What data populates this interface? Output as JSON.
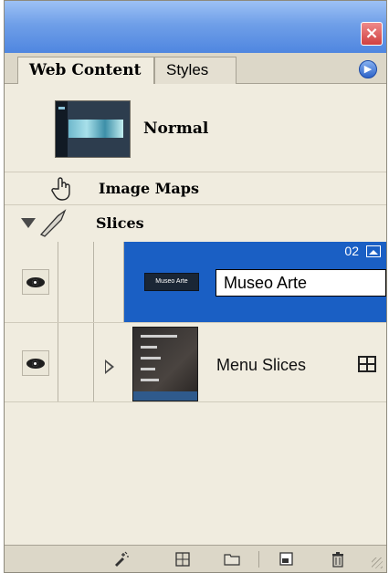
{
  "window": {
    "close_label": "×"
  },
  "tabs": [
    {
      "label": "Web Content",
      "active": true
    },
    {
      "label": "Styles",
      "active": false
    }
  ],
  "panel_menu_icon": "panel-menu-arrow-icon",
  "rows": {
    "normal": {
      "label": "Normal"
    },
    "image_maps": {
      "label": "Image Maps"
    },
    "slices": {
      "label": "Slices"
    },
    "museo": {
      "number": "02",
      "thumb_text": "Museo Arte",
      "name_value": "Museo Arte",
      "selected_color": "#1a5fc4"
    },
    "menu_slices": {
      "label": "Menu Slices"
    }
  },
  "bottom_toolbar": {
    "icons": [
      "new-slice-icon",
      "new-image-map-icon",
      "new-folder-icon",
      "new-layer-icon",
      "delete-icon"
    ]
  }
}
